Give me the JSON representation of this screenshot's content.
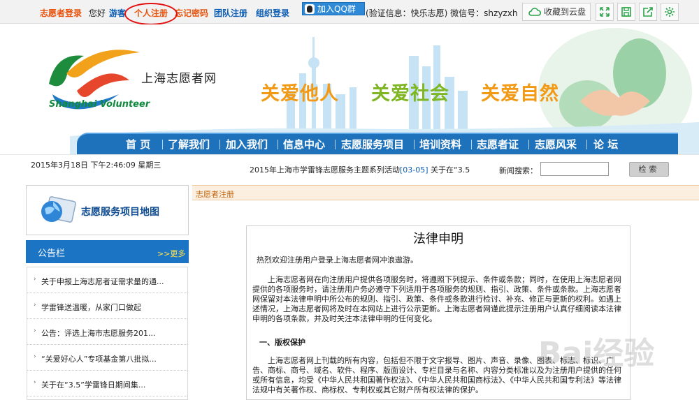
{
  "topbar": {
    "login": "志愿者登录",
    "greeting": "您好",
    "guest": "游客",
    "register": "个人注册",
    "forgot": "忘记密码",
    "team_register": "团队注册",
    "org_login": "组织登录",
    "qq_group": "加入QQ群",
    "verify_info": "(验证信息：快乐志愿) 微信号：shzyzxh",
    "save_cloud": "收藏到云盘"
  },
  "header": {
    "site_name": "上海志愿者网",
    "site_en": "Shanghai Volunteer",
    "slogans": [
      "关爱他人",
      "关爱社会",
      "关爱自然"
    ]
  },
  "nav": {
    "items": [
      "首 页",
      "了解我们",
      "加入我们",
      "信息中心",
      "志愿服务项目",
      "培训资料",
      "志愿者证",
      "志愿风采",
      "论 坛"
    ]
  },
  "info": {
    "date": "2015年3月18日  下午2:46:09  星期三",
    "marquee_title": "2015年上海市学雷锋志愿服务主题系列活动",
    "marquee_date": "[03-05]",
    "marquee_tail": "关于在“3.5",
    "search_label": "新闻搜索：",
    "search_placeholder": "",
    "search_button": "检索"
  },
  "sidebar": {
    "map_title": "志愿服务项目地图",
    "notice_title": "公告栏",
    "notice_more": ">>更多",
    "notices": [
      "关于申报上海志愿者证需求量的通...",
      "学雷锋送温暖，从家门口做起",
      "公告：评选上海市志愿服务201...",
      "“关爱好心人”专项基金第八批拟...",
      "关于在“3.5”学雷锋日期间集..."
    ]
  },
  "main": {
    "breadcrumb": "志愿者注册",
    "legal_title": "法律申明",
    "welcome": "热烈欢迎注册用户登录上海志愿者网冲浪遨游。",
    "para1": "上海志愿者网在向注册用户提供各项服务时，将遵照下列提示、条件或条款；同时，在使用上海志愿者网提供的各项服务时，请注册用户务必遵守下列适用于各项服务的规则、指引、政策、条件或条款。上海志愿者网保留对本法律申明中所公布的规则、指引、政策、条件或条款进行检讨、补充、修正与更新的权利。如遇上述情况，上海志愿者网将及时在本网站上进行公示更新。上海志愿者网谨此提示注册用户认真仔细阅读本法律申明的各项条款，并及时关注本法律申明的任何变化。",
    "section1": "一、版权保护",
    "para2": "上海志愿者网上刊载的所有内容，包括但不限于文字报导、图片、声音、录像、图表、标志、标识、广告、商标、商号、域名、软件、程序、版面设计、专栏目录与名称、内容分类标准以及为注册用户提供的任何或所有信息，均受《中华人民共和国著作权法》、《中华人民共和国商标法》、《中华人民共和国专利法》等法律法规中有关著作权、商标权、专利权或其它财产所有权法律的保护。"
  },
  "watermark": "Bai经验",
  "colors": {
    "nav_blue": "#1e72bb",
    "accent_orange": "#e8530e",
    "link_blue": "#0b5db6",
    "circle_red": "#e21010"
  }
}
